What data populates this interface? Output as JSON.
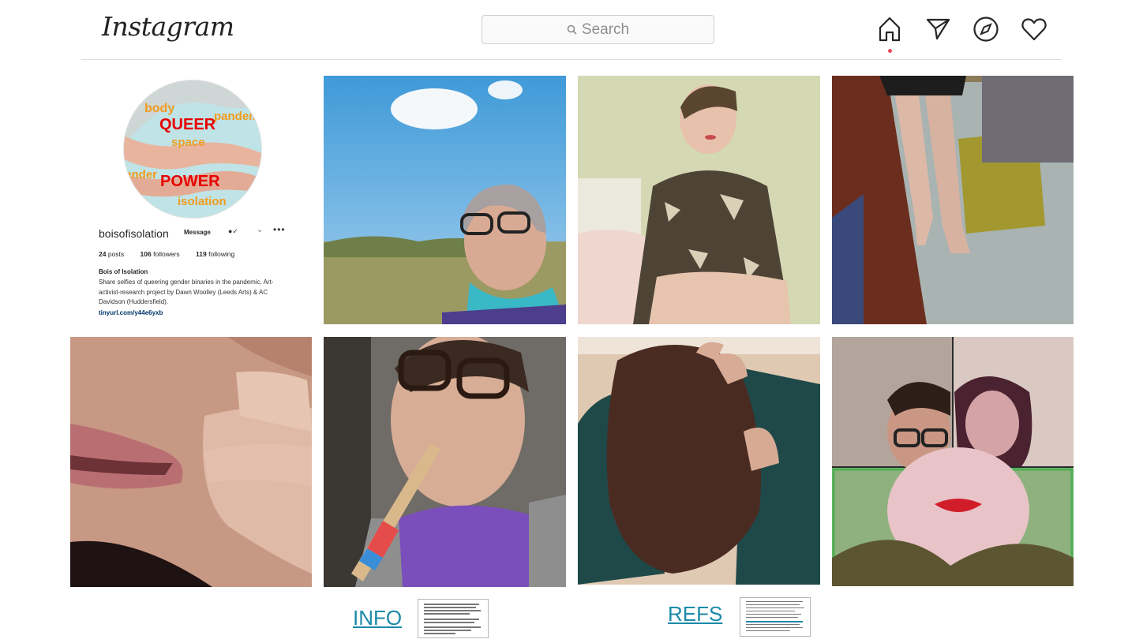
{
  "header": {
    "logo": "Instagram",
    "search_placeholder": "Search",
    "icons": [
      "home-icon",
      "direct-message-icon",
      "explore-compass-icon",
      "activity-heart-icon"
    ],
    "notification_dot_color": "#ed4956"
  },
  "profile": {
    "avatar_words": [
      "body",
      "pandemic",
      "QUEER",
      "space",
      "gender",
      "POWER",
      "isolation"
    ],
    "username": "boisofisolation",
    "message_label": "Message",
    "stats": {
      "posts_count": "24",
      "posts_label": "posts",
      "followers_count": "106",
      "followers_label": "followers",
      "following_count": "119",
      "following_label": "following"
    },
    "bio_name": "Bois of Isolation",
    "bio_text": "Share selfies of queering gender binaries in the pandemic. Art-activist-research project by Dawn Woolley (Leeds Arts) & AC Davidson (Huddersfield).",
    "bio_link": "tinyurl.com/y44e6yxb"
  },
  "posts": [
    "selfie-with-sky-and-field",
    "portrait-in-patterned-shirt",
    "legs-in-mirror",
    "closeup-lips-and-fingers",
    "portrait-with-rainbow-pencil",
    "back-of-head-long-hair",
    "video-call-collage"
  ],
  "links": {
    "info_label": "INFO",
    "refs_label": "REFS",
    "link_color": "#1a8aa8"
  }
}
